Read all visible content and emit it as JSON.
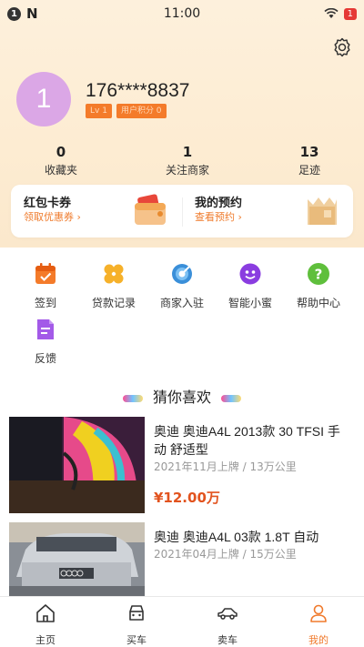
{
  "statusbar": {
    "badge": "1",
    "app_letter": "N",
    "time": "11:00",
    "battery": "1"
  },
  "profile": {
    "avatar_initial": "1",
    "phone": "176****8837",
    "level": "Lv 1",
    "points": "用户积分 0"
  },
  "stats": [
    {
      "value": "0",
      "label": "收藏夹"
    },
    {
      "value": "1",
      "label": "关注商家"
    },
    {
      "value": "13",
      "label": "足迹"
    }
  ],
  "card": {
    "left_title": "红包卡券",
    "left_sub": "领取优惠券",
    "right_title": "我的预约",
    "right_sub": "查看预约"
  },
  "menu": [
    {
      "label": "签到",
      "icon": "calendar-icon"
    },
    {
      "label": "贷款记录",
      "icon": "flower-icon"
    },
    {
      "label": "商家入驻",
      "icon": "target-icon"
    },
    {
      "label": "智能小蜜",
      "icon": "assistant-icon"
    },
    {
      "label": "帮助中心",
      "icon": "help-icon"
    },
    {
      "label": "反馈",
      "icon": "feedback-icon"
    }
  ],
  "guess_title": "猜你喜欢",
  "cars": [
    {
      "title": "奥迪 奥迪A4L 2013款 30 TFSI 手动 舒适型",
      "meta": "2021年11月上牌 / 13万公里",
      "price": "¥12.00万"
    },
    {
      "title": "奥迪 奥迪A4L 03款 1.8T 自动",
      "meta": "2021年04月上牌 / 15万公里",
      "price": ""
    }
  ],
  "tabs": [
    {
      "label": "主页",
      "icon": "home-icon"
    },
    {
      "label": "买车",
      "icon": "car-front-icon"
    },
    {
      "label": "卖车",
      "icon": "car-side-icon"
    },
    {
      "label": "我的",
      "icon": "profile-icon"
    }
  ],
  "colors": {
    "accent": "#f07a2c",
    "price": "#e2531e",
    "avatar": "#dba7e6"
  }
}
